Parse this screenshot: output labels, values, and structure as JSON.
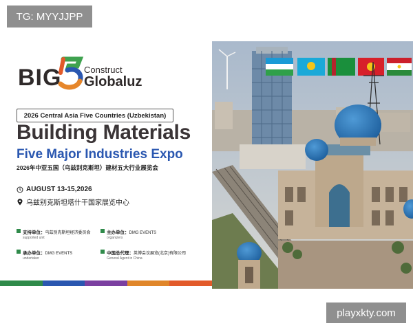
{
  "tg_badge": "TG: MYYJJPP",
  "logo": {
    "big": "BIG",
    "construct": "Construct",
    "globaluz": "Globaluz"
  },
  "subtitle": "2026 Central Asia Five Countries (Uzbekistan)",
  "title_main": "Building Materials",
  "title_second": "Five Major Industries Expo",
  "title_cn": "2026年中亚五国（乌兹别克斯坦）建材五大行业展览会",
  "date": "AUGUST 13-15,2026",
  "venue": "乌兹别克斯坦塔什干国家展览中心",
  "organizers": [
    {
      "role": "支持单位：",
      "name": "乌兹别克斯坦经济委员会",
      "en": "supported unit"
    },
    {
      "role": "主办单位：",
      "name": "DMG EVENTS",
      "en": "organizers"
    },
    {
      "role": "承办单位：",
      "name": "DMG EVENTS",
      "en": "undertaker"
    },
    {
      "role": "中国总代理：",
      "name": "英博会议展览(北京)有限公司",
      "en": "General Agent in China"
    }
  ],
  "watermark": "playxkty.com",
  "colors": {
    "title": "#3a3436",
    "accent_blue": "#2a57b0",
    "stripe": [
      "#2f8a4a",
      "#2a57b0",
      "#7b3fa0",
      "#e0862a",
      "#e25a2a"
    ]
  },
  "flags": [
    "uzbekistan-flag",
    "kazakhstan-flag",
    "turkmenistan-flag",
    "kyrgyzstan-flag",
    "tajikistan-flag"
  ]
}
